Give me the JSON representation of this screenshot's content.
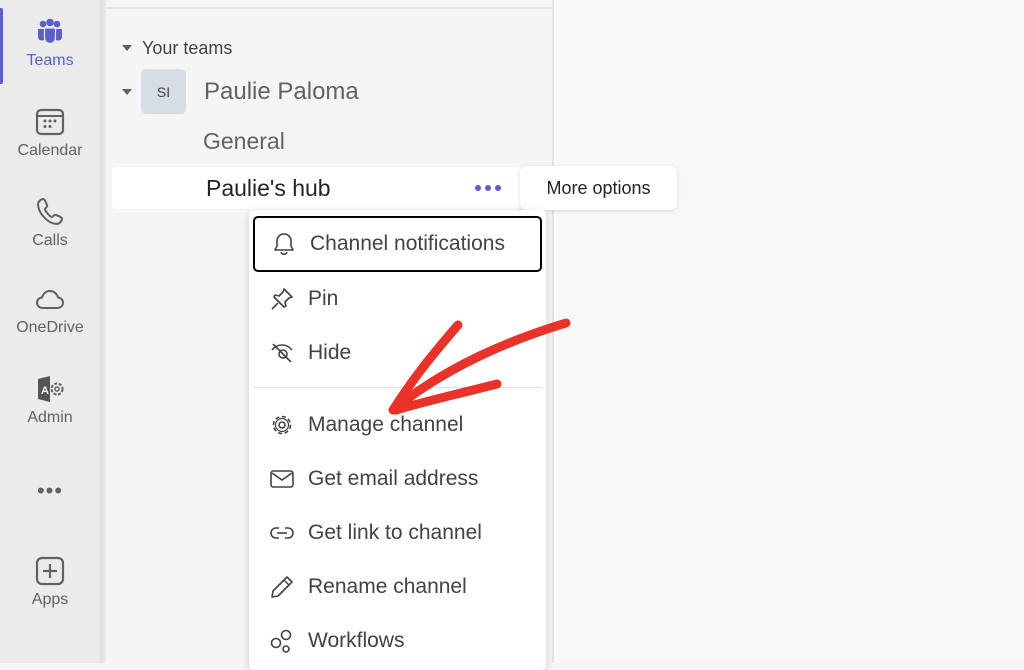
{
  "rail": {
    "items": [
      {
        "label": "Teams",
        "icon": "teams-icon",
        "active": true
      },
      {
        "label": "Calendar",
        "icon": "calendar-icon"
      },
      {
        "label": "Calls",
        "icon": "phone-icon"
      },
      {
        "label": "OneDrive",
        "icon": "cloud-icon"
      },
      {
        "label": "Admin",
        "icon": "admin-icon"
      },
      {
        "label": "",
        "icon": "more-apps-icon"
      },
      {
        "label": "Apps",
        "icon": "add-app-icon"
      }
    ],
    "admin_glyph": "A",
    "more_glyph": "•••"
  },
  "teams_pane": {
    "section_label": "Your teams",
    "team": {
      "avatar_initials": "SI",
      "name": "Paulie Paloma",
      "channels": [
        {
          "name": "General"
        },
        {
          "name": "Paulie's hub",
          "selected": true
        }
      ]
    }
  },
  "tooltip": {
    "text": "More options"
  },
  "context_menu": {
    "items": [
      {
        "label": "Channel notifications",
        "icon": "bell-icon",
        "focused": true
      },
      {
        "label": "Pin",
        "icon": "pin-icon"
      },
      {
        "label": "Hide",
        "icon": "eye-off-icon"
      },
      {
        "label": "Manage channel",
        "icon": "gear-icon"
      },
      {
        "label": "Get email address",
        "icon": "mail-icon"
      },
      {
        "label": "Get link to channel",
        "icon": "link-icon"
      },
      {
        "label": "Rename channel",
        "icon": "pencil-icon"
      },
      {
        "label": "Workflows",
        "icon": "workflows-icon"
      }
    ]
  },
  "colors": {
    "accent": "#5b5fc7",
    "annotation_arrow": "#e8322a"
  }
}
